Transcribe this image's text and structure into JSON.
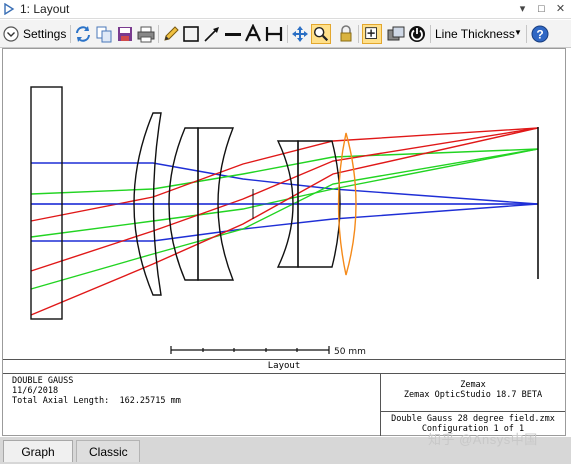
{
  "window": {
    "title": "1: Layout",
    "buttons": {
      "dropdown": "▾",
      "restore": "□",
      "close": "✕"
    }
  },
  "toolbar": {
    "settings_label": "Settings",
    "line_thickness_label": "Line Thickness",
    "icons": [
      "settings-chevron-icon",
      "refresh-icon",
      "copy-icon",
      "save-icon",
      "print-icon",
      "pencil-icon",
      "rectangle-icon",
      "arrow-icon",
      "line-icon",
      "text-icon",
      "dimension-icon",
      "pan-icon",
      "zoom-icon",
      "lock-icon",
      "fit-window-icon",
      "layers-icon",
      "power-icon",
      "help-icon"
    ]
  },
  "layout": {
    "scale_label": "50 mm",
    "caption": "Layout",
    "ray_colors": {
      "blue": "#1f2fd6",
      "green": "#22d422",
      "red": "#e01818",
      "orange": "#f58a1a"
    }
  },
  "info": {
    "lines": [
      "DOUBLE GAUSS",
      "11/6/2018",
      "Total Axial Length:  162.25715 mm"
    ],
    "company": "Zemax",
    "product": "Zemax OpticStudio 18.7  BETA",
    "file": "Double Gauss 28 degree field.zmx",
    "configuration": "Configuration 1 of 1"
  },
  "tabs": [
    {
      "label": "Graph",
      "active": true
    },
    {
      "label": "Classic",
      "active": false
    }
  ],
  "watermark": "知乎 @Ansys中国"
}
